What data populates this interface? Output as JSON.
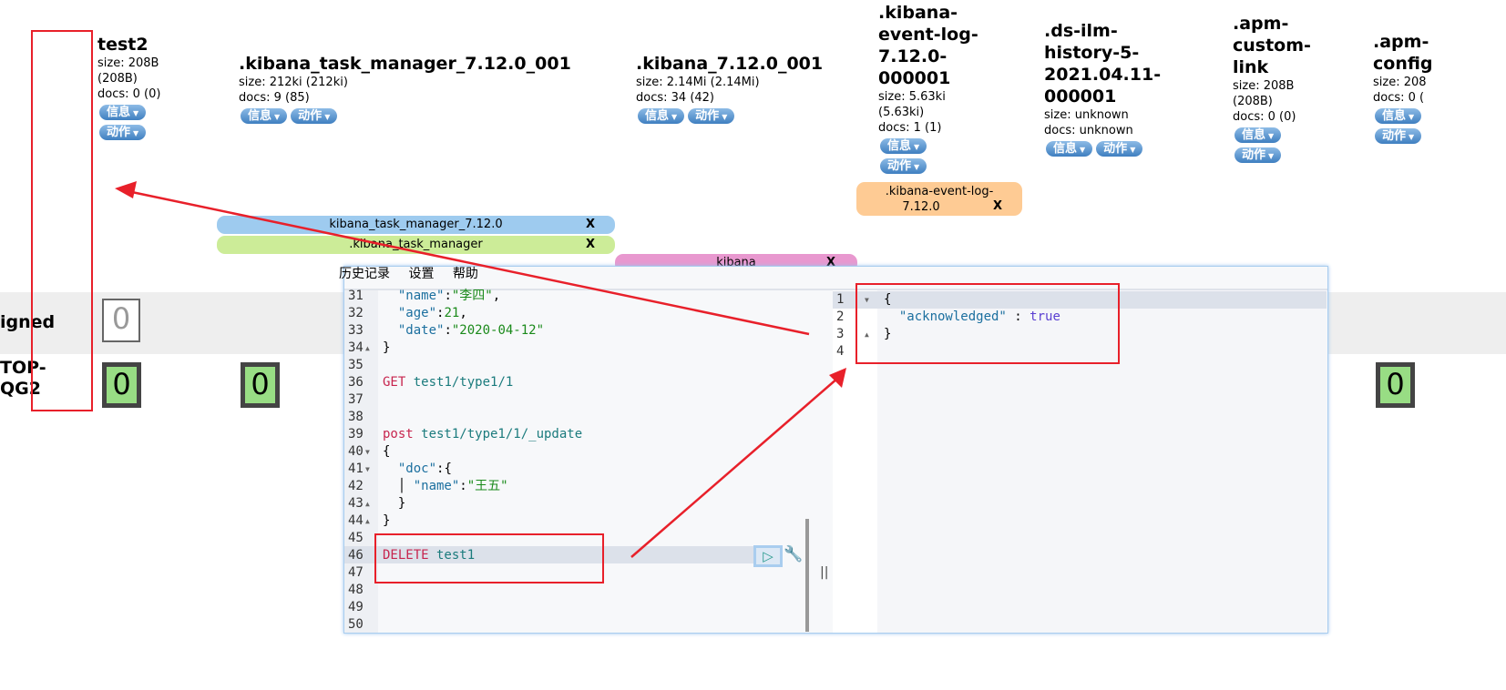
{
  "indices": [
    {
      "name": "test2",
      "size": "size: 208B",
      "size2": "(208B)",
      "docs": "docs: 0 (0)"
    },
    {
      "name": ".kibana_task_manager_7.12.0_001",
      "size": "size: 212ki (212ki)",
      "docs": "docs: 9 (85)"
    },
    {
      "name": ".kibana_7.12.0_001",
      "size": "size: 2.14Mi (2.14Mi)",
      "docs": "docs: 34 (42)"
    },
    {
      "name_lines": [
        ".kibana-",
        "event-log-",
        "7.12.0-",
        "000001"
      ],
      "size": "size: 5.63ki",
      "size2": "(5.63ki)",
      "docs": "docs: 1 (1)"
    },
    {
      "name_lines": [
        ".ds-ilm-",
        "history-5-",
        "2021.04.11-",
        "000001"
      ],
      "size": "size: unknown",
      "docs": "docs: unknown"
    },
    {
      "name_lines": [
        ".apm-",
        "custom-",
        "link"
      ],
      "size": "size: 208B",
      "size2": "(208B)",
      "docs": "docs: 0 (0)"
    },
    {
      "name_lines": [
        ".apm-",
        "config"
      ],
      "size": "size: 208",
      "docs": "docs: 0 ("
    }
  ],
  "buttons": {
    "info": "信息",
    "action": "动作",
    "caret": "▼"
  },
  "aliases": [
    {
      "label": "kibana_task_manager_7.12.0",
      "close": "X",
      "color": "#9ecbef"
    },
    {
      "label": ".kibana_task_manager",
      "close": "X",
      "color": "#ccec98"
    },
    {
      "label": "kibana",
      "close": "X",
      "color": "#e898cf"
    },
    {
      "label_lines": [
        ".kibana-event-log-",
        "7.12.0"
      ],
      "close": "X",
      "color": "#fecb94"
    }
  ],
  "rows": [
    {
      "label": "igned",
      "counts": [
        "0"
      ]
    },
    {
      "label_lines": [
        "TOP-",
        "QG2"
      ],
      "counts": [
        "0",
        "0",
        "0"
      ]
    }
  ],
  "console": {
    "menu": [
      "历史记录",
      "设置",
      "帮助"
    ],
    "request_lines": [
      {
        "n": "31",
        "parts": [
          [
            "  ",
            ""
          ],
          [
            "\"name\"",
            "key"
          ],
          [
            ":",
            ""
          ],
          [
            "\"李四\"",
            "str"
          ],
          [
            ",",
            ""
          ]
        ]
      },
      {
        "n": "32",
        "parts": [
          [
            "  ",
            ""
          ],
          [
            "\"age\"",
            "key"
          ],
          [
            ":",
            ""
          ],
          [
            "21",
            "num"
          ],
          [
            ",",
            ""
          ]
        ]
      },
      {
        "n": "33",
        "parts": [
          [
            "  ",
            ""
          ],
          [
            "\"date\"",
            "key"
          ],
          [
            ":",
            ""
          ],
          [
            "\"2020-04-12\"",
            "str"
          ]
        ]
      },
      {
        "n": "34",
        "fold": "▲",
        "parts": [
          [
            "}",
            ""
          ]
        ]
      },
      {
        "n": "35",
        "parts": []
      },
      {
        "n": "36",
        "parts": [
          [
            "GET",
            "kw"
          ],
          [
            " test1/type1/1",
            "url"
          ]
        ]
      },
      {
        "n": "37",
        "parts": []
      },
      {
        "n": "38",
        "parts": []
      },
      {
        "n": "39",
        "parts": [
          [
            "post",
            "kw"
          ],
          [
            " test1/type1/1/_update",
            "url"
          ]
        ]
      },
      {
        "n": "40",
        "fold": "▼",
        "parts": [
          [
            "{",
            ""
          ]
        ]
      },
      {
        "n": "41",
        "fold": "▼",
        "parts": [
          [
            "  ",
            ""
          ],
          [
            "\"doc\"",
            "key"
          ],
          [
            ":{",
            ""
          ]
        ]
      },
      {
        "n": "42",
        "parts": [
          [
            "  │ ",
            ""
          ],
          [
            "\"name\"",
            "key"
          ],
          [
            ":",
            ""
          ],
          [
            "\"王五\"",
            "str"
          ]
        ]
      },
      {
        "n": "43",
        "fold": "▲",
        "parts": [
          [
            "  }",
            ""
          ]
        ]
      },
      {
        "n": "44",
        "fold": "▲",
        "parts": [
          [
            "}",
            ""
          ]
        ]
      },
      {
        "n": "45",
        "parts": []
      },
      {
        "n": "46",
        "parts": [
          [
            "DELETE",
            "kw"
          ],
          [
            " test1",
            "url"
          ]
        ]
      },
      {
        "n": "47",
        "parts": []
      },
      {
        "n": "48",
        "parts": []
      },
      {
        "n": "49",
        "parts": []
      },
      {
        "n": "50",
        "parts": []
      }
    ],
    "response_lines": [
      {
        "n": "1",
        "fold": "▼",
        "parts": [
          [
            "{",
            ""
          ]
        ]
      },
      {
        "n": "2",
        "parts": [
          [
            "  ",
            ""
          ],
          [
            "\"acknowledged\"",
            "key"
          ],
          [
            " : ",
            ""
          ],
          [
            "true",
            "bool"
          ]
        ]
      },
      {
        "n": "3",
        "fold": "▲",
        "parts": [
          [
            "}",
            ""
          ]
        ]
      },
      {
        "n": "4",
        "parts": []
      }
    ],
    "resizer": "||"
  }
}
